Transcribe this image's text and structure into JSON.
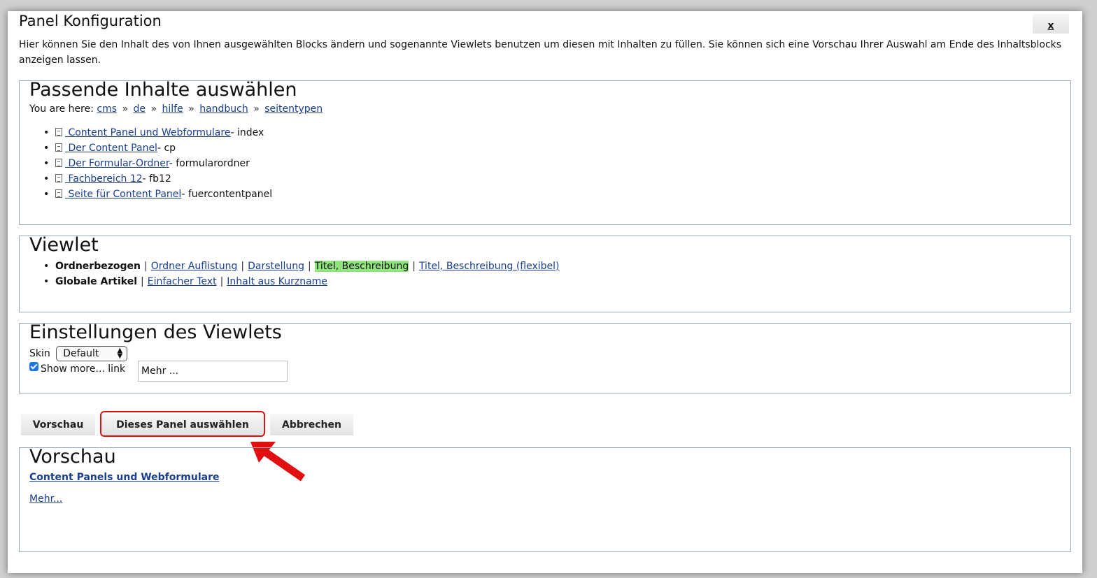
{
  "dialog": {
    "title": "Panel Konfiguration",
    "close_label": "x",
    "intro": "Hier können Sie den Inhalt des von Ihnen ausgewählten Blocks ändern und sogenannte Viewlets benutzen um diesen mit Inhalten zu füllen. Sie können sich eine Vorschau Ihrer Auswahl am Ende des Inhaltsblocks anzeigen lassen."
  },
  "content": {
    "title": "Passende Inhalte auswählen",
    "breadcrumb_prefix": "You are here:",
    "breadcrumb": [
      "cms",
      "de",
      "hilfe",
      "handbuch",
      "seitentypen"
    ],
    "breadcrumb_separator": "»",
    "pages": [
      {
        "label": " Content Panel und Webformulare",
        "suffix": "- index"
      },
      {
        "label": " Der Content Panel",
        "suffix": "- cp"
      },
      {
        "label": " Der Formular-Ordner",
        "suffix": "- formularordner"
      },
      {
        "label": " Fachbereich 12",
        "suffix": "- fb12"
      },
      {
        "label": " Seite für Content Panel",
        "suffix": "- fuercontentpanel"
      }
    ]
  },
  "viewlet": {
    "title": "Viewlet",
    "groups": [
      {
        "label": "Ordnerbezogen",
        "options": [
          "Ordner Auflistung",
          "Darstellung",
          "Titel, Beschreibung",
          "Titel, Beschreibung (flexibel)"
        ],
        "selected": "Titel, Beschreibung"
      },
      {
        "label": "Globale Artikel",
        "options": [
          "Einfacher Text",
          "Inhalt aus Kurzname"
        ],
        "selected": null
      }
    ],
    "separator": "|",
    "selected_color": "#8fe67c"
  },
  "settings": {
    "title": "Einstellungen des Viewlets",
    "skin_label": "Skin",
    "skin_value": "Default",
    "show_more_label": "Show more... link",
    "show_more_checked": true,
    "more_text": "Mehr ..."
  },
  "buttons": {
    "preview": "Vorschau",
    "select": "Dieses Panel auswählen",
    "cancel": "Abbrechen"
  },
  "preview": {
    "title": "Vorschau",
    "heading_link": "Content Panels und Webformulare",
    "more_link": "Mehr..."
  },
  "colors": {
    "link": "#1a3f8f",
    "border": "#9aa9b9",
    "annotation": "#e01010"
  }
}
